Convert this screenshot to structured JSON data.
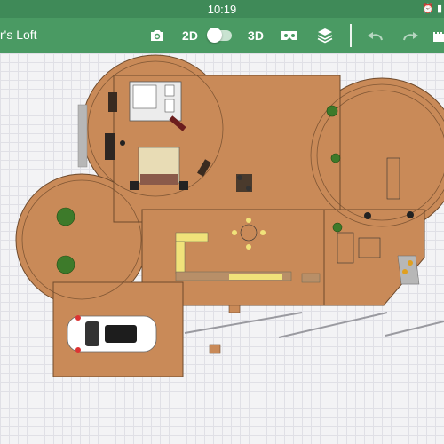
{
  "status_bar": {
    "time": "10:19"
  },
  "toolbar": {
    "project_title": "r's Loft",
    "mode_2d_label": "2D",
    "mode_3d_label": "3D",
    "accent_color": "#4a9a63",
    "icons": [
      "camera-icon",
      "toggle-switch",
      "vr-headset-icon",
      "layers-icon",
      "undo-icon",
      "redo-icon",
      "castle-icon"
    ]
  },
  "canvas": {
    "floor_color": "#c98a58",
    "grid_color": "#e0e0e6"
  }
}
